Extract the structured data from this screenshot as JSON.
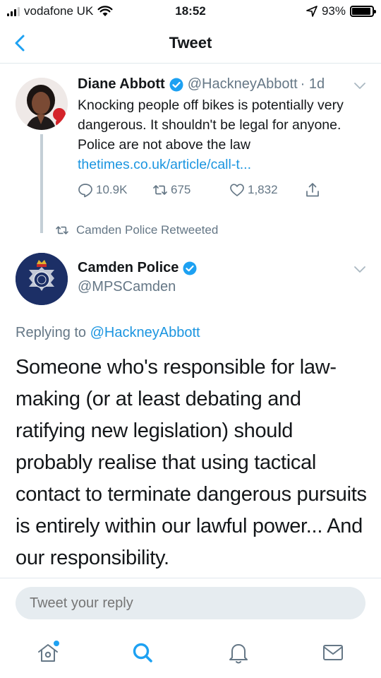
{
  "status_bar": {
    "carrier": "vodafone UK",
    "time": "18:52",
    "battery": "93%",
    "battery_level": 0.93
  },
  "nav": {
    "title": "Tweet"
  },
  "parent_tweet": {
    "name": "Diane Abbott",
    "handle": "@HackneyAbbott",
    "age": "· 1d",
    "text": "Knocking people off bikes is potentially very dangerous. It shouldn't be legal for anyone. Police are not above the law",
    "link": "thetimes.co.uk/article/call-t...",
    "replies": "10.9K",
    "retweets": "675",
    "likes": "1,832"
  },
  "retweeted_by": "Camden Police Retweeted",
  "main_tweet": {
    "name": "Camden Police",
    "handle": "@MPSCamden",
    "replying_prefix": "Replying to",
    "replying_to": "@HackneyAbbott",
    "text": "Someone who's responsible for law-making (or at least debating and ratifying new legislation) should probably realise that using tactical contact to terminate dangerous pursuits is entirely within our lawful power... And our responsibility."
  },
  "reply": {
    "placeholder": "Tweet your reply"
  },
  "tabs": [
    {
      "icon": "home-icon"
    },
    {
      "icon": "search-icon"
    },
    {
      "icon": "notifications-icon"
    },
    {
      "icon": "messages-icon"
    }
  ],
  "colors": {
    "accent": "#1da1f2",
    "link": "#1b95e0",
    "secondary_text": "#657786"
  }
}
